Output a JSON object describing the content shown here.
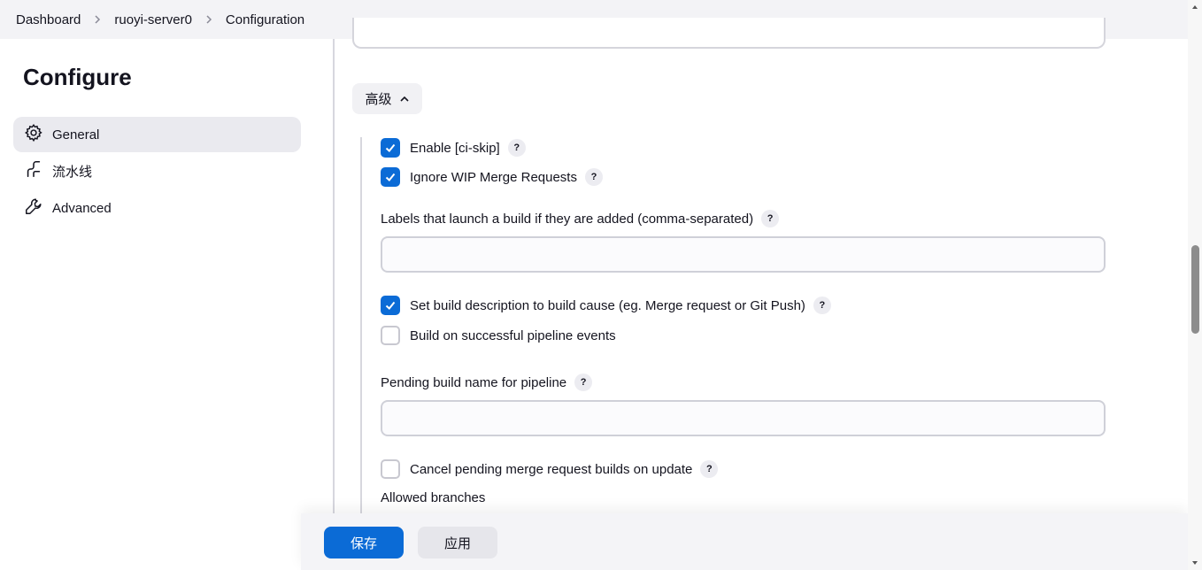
{
  "breadcrumb": {
    "items": [
      "Dashboard",
      "ruoyi-server0",
      "Configuration"
    ]
  },
  "sidebar": {
    "title": "Configure",
    "items": [
      {
        "label": "General",
        "icon": "gear-icon",
        "active": true
      },
      {
        "label": "流水线",
        "icon": "pipeline-icon",
        "active": false
      },
      {
        "label": "Advanced",
        "icon": "wrench-icon",
        "active": false
      }
    ]
  },
  "main": {
    "advanced_toggle": "高级",
    "options": {
      "ci_skip": {
        "label": "Enable [ci-skip]",
        "checked": true
      },
      "ignore_wip": {
        "label": "Ignore WIP Merge Requests",
        "checked": true
      },
      "labels_field": {
        "label": "Labels that launch a build if they are added (comma-separated)",
        "value": ""
      },
      "set_desc": {
        "label": "Set build description to build cause (eg. Merge request or Git Push)",
        "checked": true
      },
      "pipeline_events": {
        "label": "Build on successful pipeline events",
        "checked": false
      },
      "pending_name_field": {
        "label": "Pending build name for pipeline",
        "value": ""
      },
      "cancel_pending": {
        "label": "Cancel pending merge request builds on update",
        "checked": false
      },
      "allowed_branches": {
        "label": "Allowed branches"
      }
    },
    "help_glyph": "?"
  },
  "footer": {
    "save_label": "保存",
    "apply_label": "应用"
  },
  "colors": {
    "accent": "#0b6bd6",
    "topbar_bg": "#f3f3f6",
    "active_nav_bg": "#eaeaef"
  }
}
